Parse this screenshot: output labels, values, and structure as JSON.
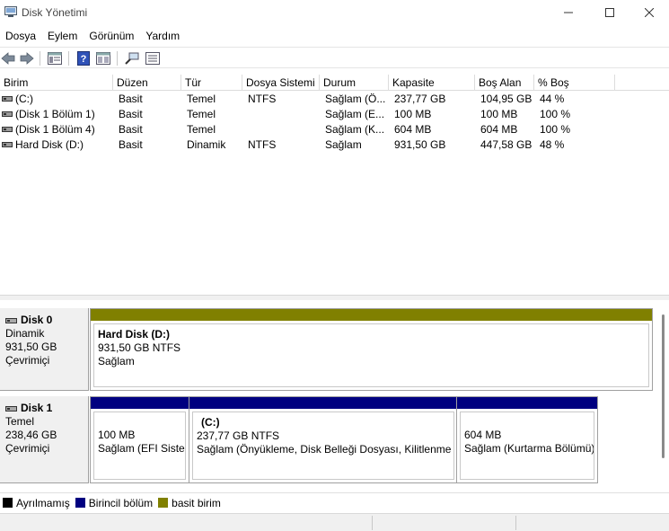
{
  "window": {
    "title": "Disk Yönetimi"
  },
  "menu": [
    "Dosya",
    "Eylem",
    "Görünüm",
    "Yardım"
  ],
  "toolbar": {
    "icons": [
      "back-arrow-icon",
      "forward-arrow-icon",
      "properties-icon",
      "help-icon",
      "console-view-icon",
      "rescan-icon",
      "settings-list-icon"
    ]
  },
  "volume_list": {
    "columns": [
      "Birim",
      "Düzen",
      "Tür",
      "Dosya Sistemi",
      "Durum",
      "Kapasite",
      "Boş Alan",
      "% Boş"
    ],
    "rows": [
      [
        "(C:)",
        "Basit",
        "Temel",
        "NTFS",
        "Sağlam (Ö...",
        "237,77 GB",
        "104,95 GB",
        "44 %"
      ],
      [
        "(Disk 1 Bölüm 1)",
        "Basit",
        "Temel",
        "",
        "Sağlam (E...",
        "100 MB",
        "100 MB",
        "100 %"
      ],
      [
        "(Disk 1 Bölüm 4)",
        "Basit",
        "Temel",
        "",
        "Sağlam (K...",
        "604 MB",
        "604 MB",
        "100 %"
      ],
      [
        "Hard Disk (D:)",
        "Basit",
        "Dinamik",
        "NTFS",
        "Sağlam",
        "931,50 GB",
        "447,58 GB",
        "48 %"
      ]
    ]
  },
  "disks": [
    {
      "name": "Disk 0",
      "type": "Dinamik",
      "size": "931,50 GB",
      "status": "Çevrimiçi",
      "partitions": [
        {
          "title": "Hard Disk  (D:)",
          "line1": "931,50 GB NTFS",
          "line2": "Sağlam",
          "color": "#808000"
        }
      ]
    },
    {
      "name": "Disk 1",
      "type": "Temel",
      "size": "238,46 GB",
      "status": "Çevrimiçi",
      "partitions": [
        {
          "title": "",
          "line1": "100 MB",
          "line2": "Sağlam (EFI Sistem",
          "color": "#000080"
        },
        {
          "title": "(C:)",
          "line1": "237,77 GB NTFS",
          "line2": "Sağlam (Önyükleme, Disk Belleği Dosyası, Kilitlenme Bo",
          "color": "#000080"
        },
        {
          "title": "",
          "line1": "604 MB",
          "line2": "Sağlam (Kurtarma Bölümü)",
          "color": "#000080"
        }
      ]
    }
  ],
  "legend": [
    {
      "label": "Ayrılmamış",
      "color": "#000000"
    },
    {
      "label": "Birincil bölüm",
      "color": "#000080"
    },
    {
      "label": "basit birim",
      "color": "#808000"
    }
  ]
}
